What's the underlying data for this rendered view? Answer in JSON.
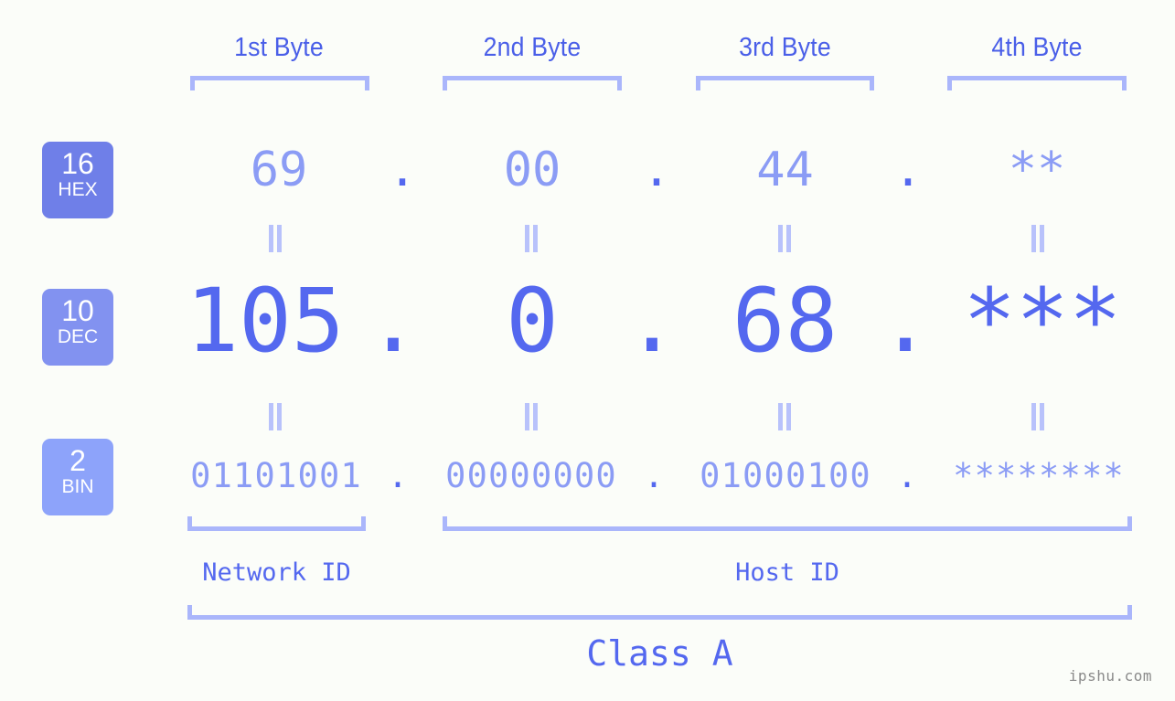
{
  "meta": {
    "background_color": "#fbfdf9",
    "accent_strong": "#5468ef",
    "accent_medium": "#8b9cf5",
    "accent_light": "#aab6fb",
    "header_color": "#4a5fe8",
    "watermark": "ipshu.com"
  },
  "byte_headers": [
    {
      "label": "1st Byte"
    },
    {
      "label": "2nd Byte"
    },
    {
      "label": "3rd Byte"
    },
    {
      "label": "4th Byte"
    }
  ],
  "bases": [
    {
      "num": "16",
      "abbr": "HEX",
      "color": "#6f7fe8"
    },
    {
      "num": "10",
      "abbr": "DEC",
      "color": "#8292f0"
    },
    {
      "num": "2",
      "abbr": "BIN",
      "color": "#8da3fa"
    }
  ],
  "rows": {
    "hex": {
      "base_num": "16",
      "base_abbr": "HEX",
      "values": [
        "69",
        "00",
        "44",
        "**"
      ],
      "separators": [
        ".",
        ".",
        "."
      ]
    },
    "dec": {
      "base_num": "10",
      "base_abbr": "DEC",
      "values": [
        "105",
        "0",
        "68",
        "***"
      ],
      "separators": [
        ".",
        ".",
        "."
      ]
    },
    "bin": {
      "base_num": "2",
      "base_abbr": "BIN",
      "values": [
        "01101001",
        "00000000",
        "01000100",
        "********"
      ],
      "separators": [
        ".",
        ".",
        "."
      ]
    }
  },
  "equals_symbol": "=",
  "regions": [
    {
      "label": "Network ID"
    },
    {
      "label": "Host ID"
    }
  ],
  "class": {
    "label": "Class A"
  }
}
